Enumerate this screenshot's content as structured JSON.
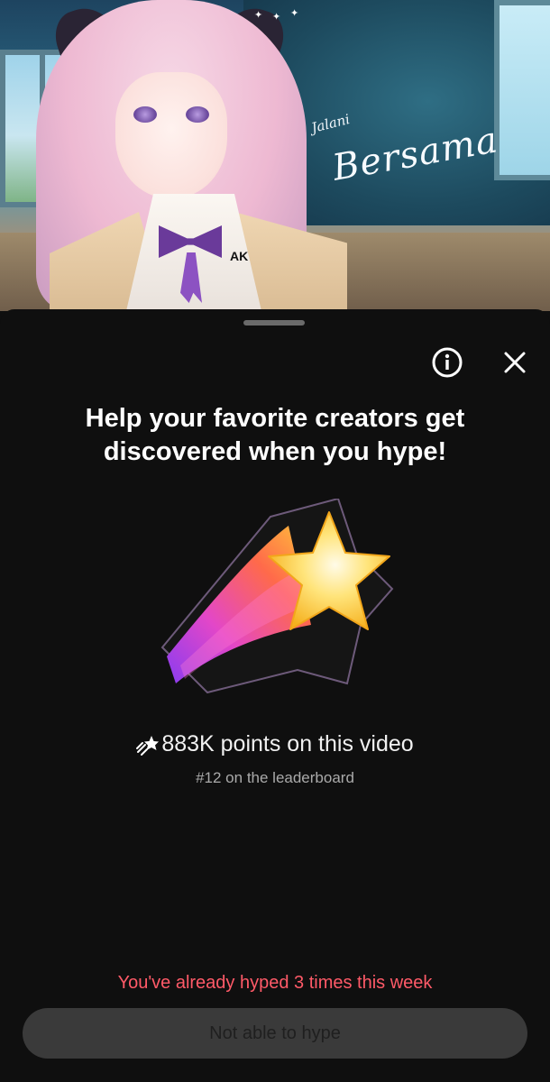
{
  "video": {
    "overlay_title_small": "Jalani",
    "overlay_title_big": "Bersama",
    "shirt_badge": "AK"
  },
  "sheet": {
    "info_icon": "info-icon",
    "close_icon": "close-icon",
    "headline": "Help your favorite creators get discovered when you hype!",
    "hype_icon": "shooting-star-icon",
    "points_text": "883K points on this video",
    "rank_text": "#12 on the leaderboard",
    "limit_message": "You've already hyped 3 times this week",
    "button_label": "Not able to hype"
  },
  "colors": {
    "background": "#0f0f0f",
    "limit_message": "#ff5a68",
    "button_bg": "#3a3a3a",
    "button_text": "#1f1f1f",
    "secondary_text": "#aaaaaa"
  }
}
